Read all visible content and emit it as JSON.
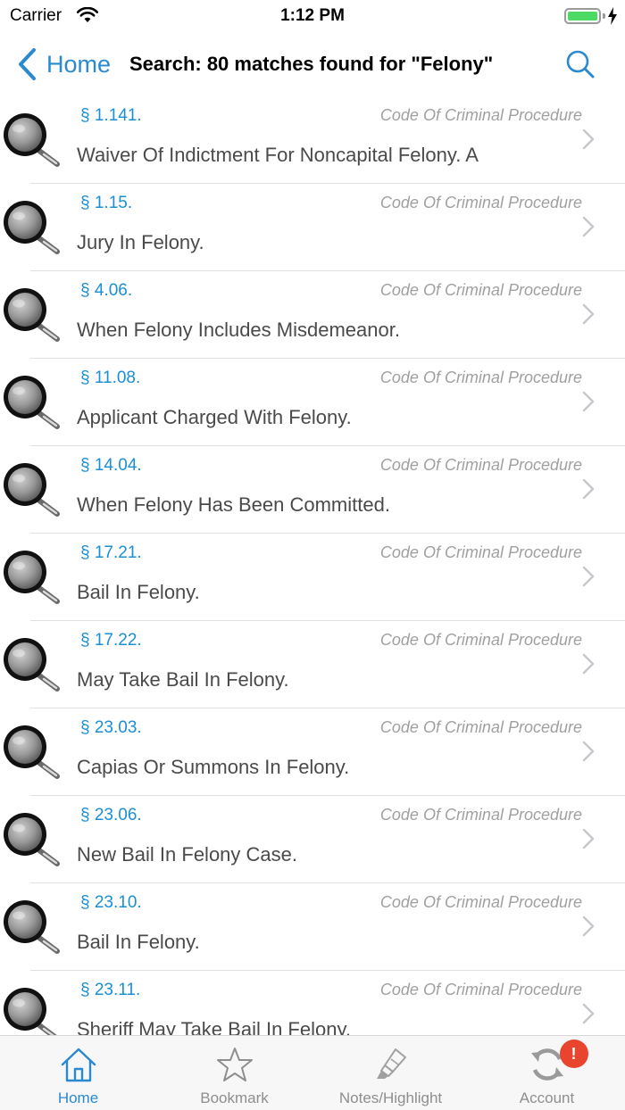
{
  "status_bar": {
    "carrier": "Carrier",
    "time": "1:12 PM"
  },
  "nav": {
    "back_label": "Home",
    "title": "Search: 80 matches found for \"Felony\""
  },
  "results": [
    {
      "section": "§ 1.141.",
      "code": "Code Of Criminal Procedure",
      "title": "Waiver Of Indictment For Noncapital Felony. A"
    },
    {
      "section": "§ 1.15.",
      "code": "Code Of Criminal Procedure",
      "title": "Jury In Felony."
    },
    {
      "section": "§ 4.06.",
      "code": "Code Of Criminal Procedure",
      "title": "When Felony Includes Misdemeanor."
    },
    {
      "section": "§ 11.08.",
      "code": "Code Of Criminal Procedure",
      "title": "Applicant Charged With Felony."
    },
    {
      "section": "§ 14.04.",
      "code": "Code Of Criminal Procedure",
      "title": "When Felony Has Been Committed."
    },
    {
      "section": "§ 17.21.",
      "code": "Code Of Criminal Procedure",
      "title": "Bail In Felony."
    },
    {
      "section": "§ 17.22.",
      "code": "Code Of Criminal Procedure",
      "title": "May Take Bail In Felony."
    },
    {
      "section": "§ 23.03.",
      "code": "Code Of Criminal Procedure",
      "title": "Capias Or Summons In Felony."
    },
    {
      "section": "§ 23.06.",
      "code": "Code Of Criminal Procedure",
      "title": "New Bail In Felony Case."
    },
    {
      "section": "§ 23.10.",
      "code": "Code Of Criminal Procedure",
      "title": "Bail In Felony."
    },
    {
      "section": "§ 23.11.",
      "code": "Code Of Criminal Procedure",
      "title": "Sheriff May Take Bail In Felony."
    }
  ],
  "tabs": [
    {
      "label": "Home",
      "icon": "home-icon",
      "active": true
    },
    {
      "label": "Bookmark",
      "icon": "star-icon",
      "active": false
    },
    {
      "label": "Notes/Highlight",
      "icon": "highlighter-icon",
      "active": false
    },
    {
      "label": "Account",
      "icon": "sync-icon",
      "active": false,
      "badge": "!"
    }
  ],
  "colors": {
    "accent": "#2a8ad0",
    "section_link": "#1a8fd6",
    "badge": "#e8442e",
    "battery": "#4cd964"
  }
}
